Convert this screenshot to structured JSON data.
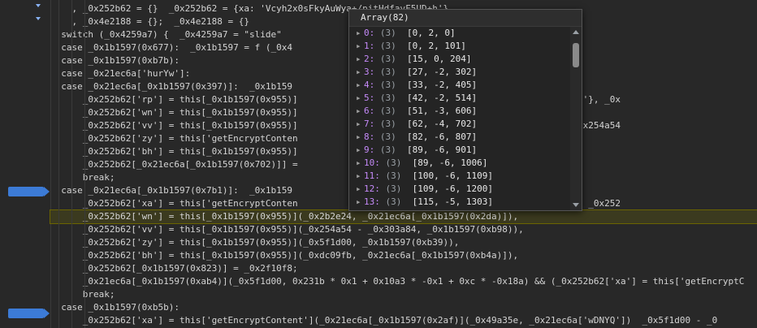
{
  "editor": {
    "lines": [
      {
        "text": "    , _0x252b62 = {}  _0x252b62 = {xa: 'Vcyh2x0sFkyAuWya+/pitHdfavF5UD+h'}",
        "indent": 3
      },
      {
        "text": "    , _0x4e2188 = {};  _0x4e2188 = {}",
        "indent": 3
      },
      {
        "text": "  switch (_0x4259a7) {  _0x4259a7 = \"slide\"",
        "indent": 2
      },
      {
        "text": "  case _0x1b1597(0x677):  _0x1b1597 = f (_0x4",
        "indent": 2
      },
      {
        "text": "  case _0x1b1597(0xb7b):",
        "indent": 2
      },
      {
        "text": "  case _0x21ec6a['hurYw']:",
        "indent": 2
      },
      {
        "text": "  case _0x21ec6a[_0x1b1597(0x397)]:  _0x1b159",
        "indent": 2
      },
      {
        "text": "      _0x252b62['rp'] = this[_0x1b1597(0x955)]                          x0sFkyAuWya+/pitHdfavF5UD+h'}, _0x",
        "indent": 3
      },
      {
        "text": "      _0x252b62['wn'] = this[_0x1b1597(0x955)]                          ay(82)",
        "indent": 3
      },
      {
        "text": "      _0x252b62['vv'] = this[_0x1b1597(0x955)]                          ), _0x21ec6a['fUHDV']),  _0x254a54",
        "indent": 3
      },
      {
        "text": "      _0x252b62['zy'] = this['getEncryptConten                          0",
        "indent": 3
      },
      {
        "text": "      _0x252b62['bh'] = this[_0x1b1597(0x955)]",
        "indent": 3
      },
      {
        "text": "      _0x252b62[_0x21ec6a[_0x1b1597(0x702)]] =",
        "indent": 3
      },
      {
        "text": "      break;",
        "indent": 3
      },
      {
        "text": "  case _0x21ec6a[_0x1b1597(0x7b1)]:  _0x1b159",
        "indent": 2
      },
      {
        "text": "      _0x252b62['xa'] = this['getEncryptConten                          21ec6a[_0x1b1597(0x335)]),  _0x252",
        "indent": 3
      },
      {
        "text": "      _0x252b62['wn'] = this[_0x1b1597(0x955)](_0x2b2e24, _0x21ec6a[_0x1b1597(0x2da)]),",
        "indent": 3,
        "exec": true
      },
      {
        "text": "      _0x252b62['vv'] = this[_0x1b1597(0x955)](_0x254a54 - _0x303a84, _0x1b1597(0xb98)),",
        "indent": 3
      },
      {
        "text": "      _0x252b62['zy'] = this[_0x1b1597(0x955)](_0x5f1d00, _0x1b1597(0xb39)),",
        "indent": 3
      },
      {
        "text": "      _0x252b62['bh'] = this[_0x1b1597(0x955)](_0xdc09fb, _0x21ec6a[_0x1b1597(0xb4a)]),",
        "indent": 3
      },
      {
        "text": "      _0x252b62[_0x1b1597(0x823)] = _0x2f10f8;",
        "indent": 3
      },
      {
        "text": "      _0x21ec6a[_0x1b1597(0xab4)](_0x5f1d00, 0x231b * 0x1 + 0x10a3 * -0x1 + 0xc * -0x18a) && (_0x252b62['xa'] = this['getEncryptC",
        "indent": 3
      },
      {
        "text": "      break;",
        "indent": 3
      },
      {
        "text": "  case _0x1b1597(0xb5b):",
        "indent": 2
      },
      {
        "text": "      _0x252b62['xa'] = this['getEncryptContent'](_0x21ec6a[_0x1b1597(0x2af)](_0x49a35e, _0x21ec6a['wDNYQ'])  _0x5f1d00 - _0",
        "indent": 3
      }
    ],
    "breakpoint_rows": [
      15,
      23
    ],
    "exec_row": 16
  },
  "popup": {
    "title": "Array(82)",
    "items": [
      {
        "index": "0",
        "length": "(3)",
        "value": "[0, 2, 0]"
      },
      {
        "index": "1",
        "length": "(3)",
        "value": "[0, 2, 101]"
      },
      {
        "index": "2",
        "length": "(3)",
        "value": "[15, 0, 204]"
      },
      {
        "index": "3",
        "length": "(3)",
        "value": "[27, -2, 302]"
      },
      {
        "index": "4",
        "length": "(3)",
        "value": "[33, -2, 405]"
      },
      {
        "index": "5",
        "length": "(3)",
        "value": "[42, -2, 514]"
      },
      {
        "index": "6",
        "length": "(3)",
        "value": "[51, -3, 606]"
      },
      {
        "index": "7",
        "length": "(3)",
        "value": "[62, -4, 702]"
      },
      {
        "index": "8",
        "length": "(3)",
        "value": "[82, -6, 807]"
      },
      {
        "index": "9",
        "length": "(3)",
        "value": "[89, -6, 901]"
      },
      {
        "index": "10",
        "length": "(3)",
        "value": "[89, -6, 1006]"
      },
      {
        "index": "11",
        "length": "(3)",
        "value": "[100, -6, 1109]"
      },
      {
        "index": "12",
        "length": "(3)",
        "value": "[109, -6, 1200]"
      },
      {
        "index": "13",
        "length": "(3)",
        "value": "[115, -5, 1303]"
      }
    ]
  }
}
